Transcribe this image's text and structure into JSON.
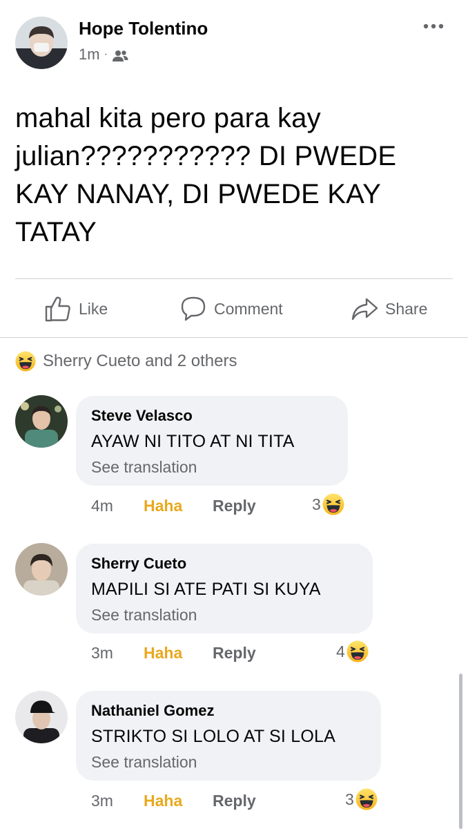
{
  "post": {
    "author": "Hope Tolentino",
    "time": "1m",
    "separator": "·",
    "audience_icon": "friends-icon",
    "text": "mahal kita pero para kay julian??????????? DI PWEDE KAY NANAY, DI PWEDE KAY TATAY"
  },
  "actions": {
    "like": "Like",
    "comment": "Comment",
    "share": "Share"
  },
  "reactions": {
    "icon": "haha-icon",
    "summary": "Sherry Cueto and 2 others"
  },
  "comments": [
    {
      "name": "Steve Velasco",
      "text": "AYAW NI TITO AT NI TITA",
      "translation": "See translation",
      "time": "4m",
      "reaction_label": "Haha",
      "reply_label": "Reply",
      "reaction_count": "3"
    },
    {
      "name": "Sherry Cueto",
      "text": "MAPILI SI ATE PATI SI KUYA",
      "translation": "See translation",
      "time": "3m",
      "reaction_label": "Haha",
      "reply_label": "Reply",
      "reaction_count": "4"
    },
    {
      "name": "Nathaniel Gomez",
      "text": "STRIKTO SI LOLO AT SI LOLA",
      "translation": "See translation",
      "time": "3m",
      "reaction_label": "Haha",
      "reply_label": "Reply",
      "reaction_count": "3"
    }
  ],
  "colors": {
    "text_primary": "#050505",
    "text_secondary": "#65676b",
    "haha_active": "#e9a81d",
    "bubble_bg": "#f0f2f5",
    "divider": "#ced0d4"
  }
}
